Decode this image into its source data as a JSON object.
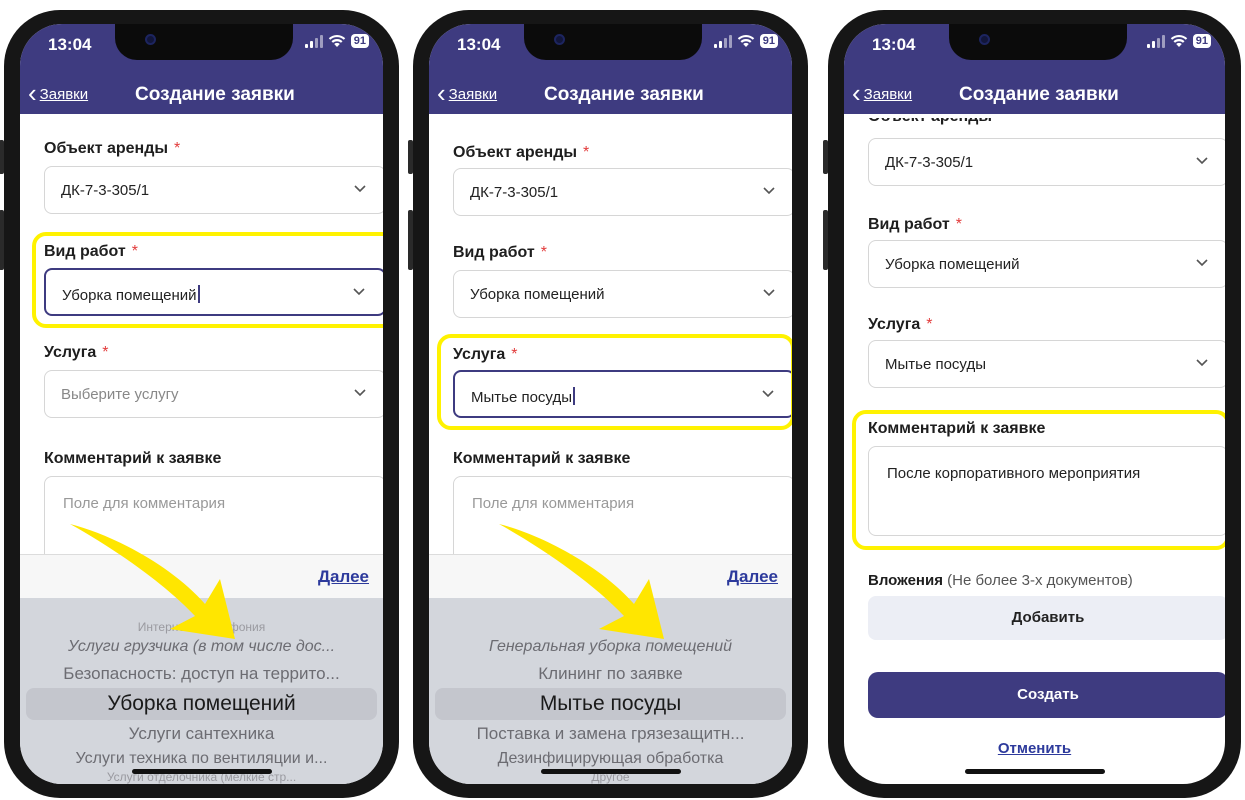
{
  "status_bar": {
    "time": "13:04",
    "battery": "91"
  },
  "nav": {
    "back_label": "Заявки",
    "title": "Создание заявки"
  },
  "form": {
    "rental_object": {
      "label": "Объект аренды",
      "required": "*",
      "value": "ДК-7-3-305/1",
      "label_partial": "Объект аренды"
    },
    "work_type": {
      "label": "Вид работ",
      "required": "*",
      "value": "Уборка помещений"
    },
    "service": {
      "label": "Услуга",
      "required": "*",
      "placeholder": "Выберите услугу",
      "value": "Мытье посуды"
    },
    "comment": {
      "label": "Комментарий к заявке",
      "placeholder": "Поле для комментария",
      "value": "После корпоративного мероприятия"
    }
  },
  "picker": {
    "next_label": "Далее",
    "work_types": [
      "Интернет и телефония",
      "Услуги грузчика (в том числе дос...",
      "Безопасность: доступ на террито...",
      "Уборка помещений",
      "Услуги сантехника",
      "Услуги техника по вентиляции и...",
      "Услуги отделочника (мелкие стр..."
    ],
    "services": [
      "Генеральная уборка помещений",
      "Клининг по заявке",
      "Мытье посуды",
      "Поставка и замена грязезащитн...",
      "Дезинфицирующая обработка",
      "Другое"
    ]
  },
  "attachments": {
    "label": "Вложения",
    "hint": "(Не более 3-х документов)",
    "add_button": "Добавить"
  },
  "actions": {
    "create": "Создать",
    "cancel": "Отменить"
  },
  "colors": {
    "header": "#3e3b80",
    "highlight": "#fff200",
    "link": "#2d3a9c",
    "required": "#e23b3b"
  }
}
